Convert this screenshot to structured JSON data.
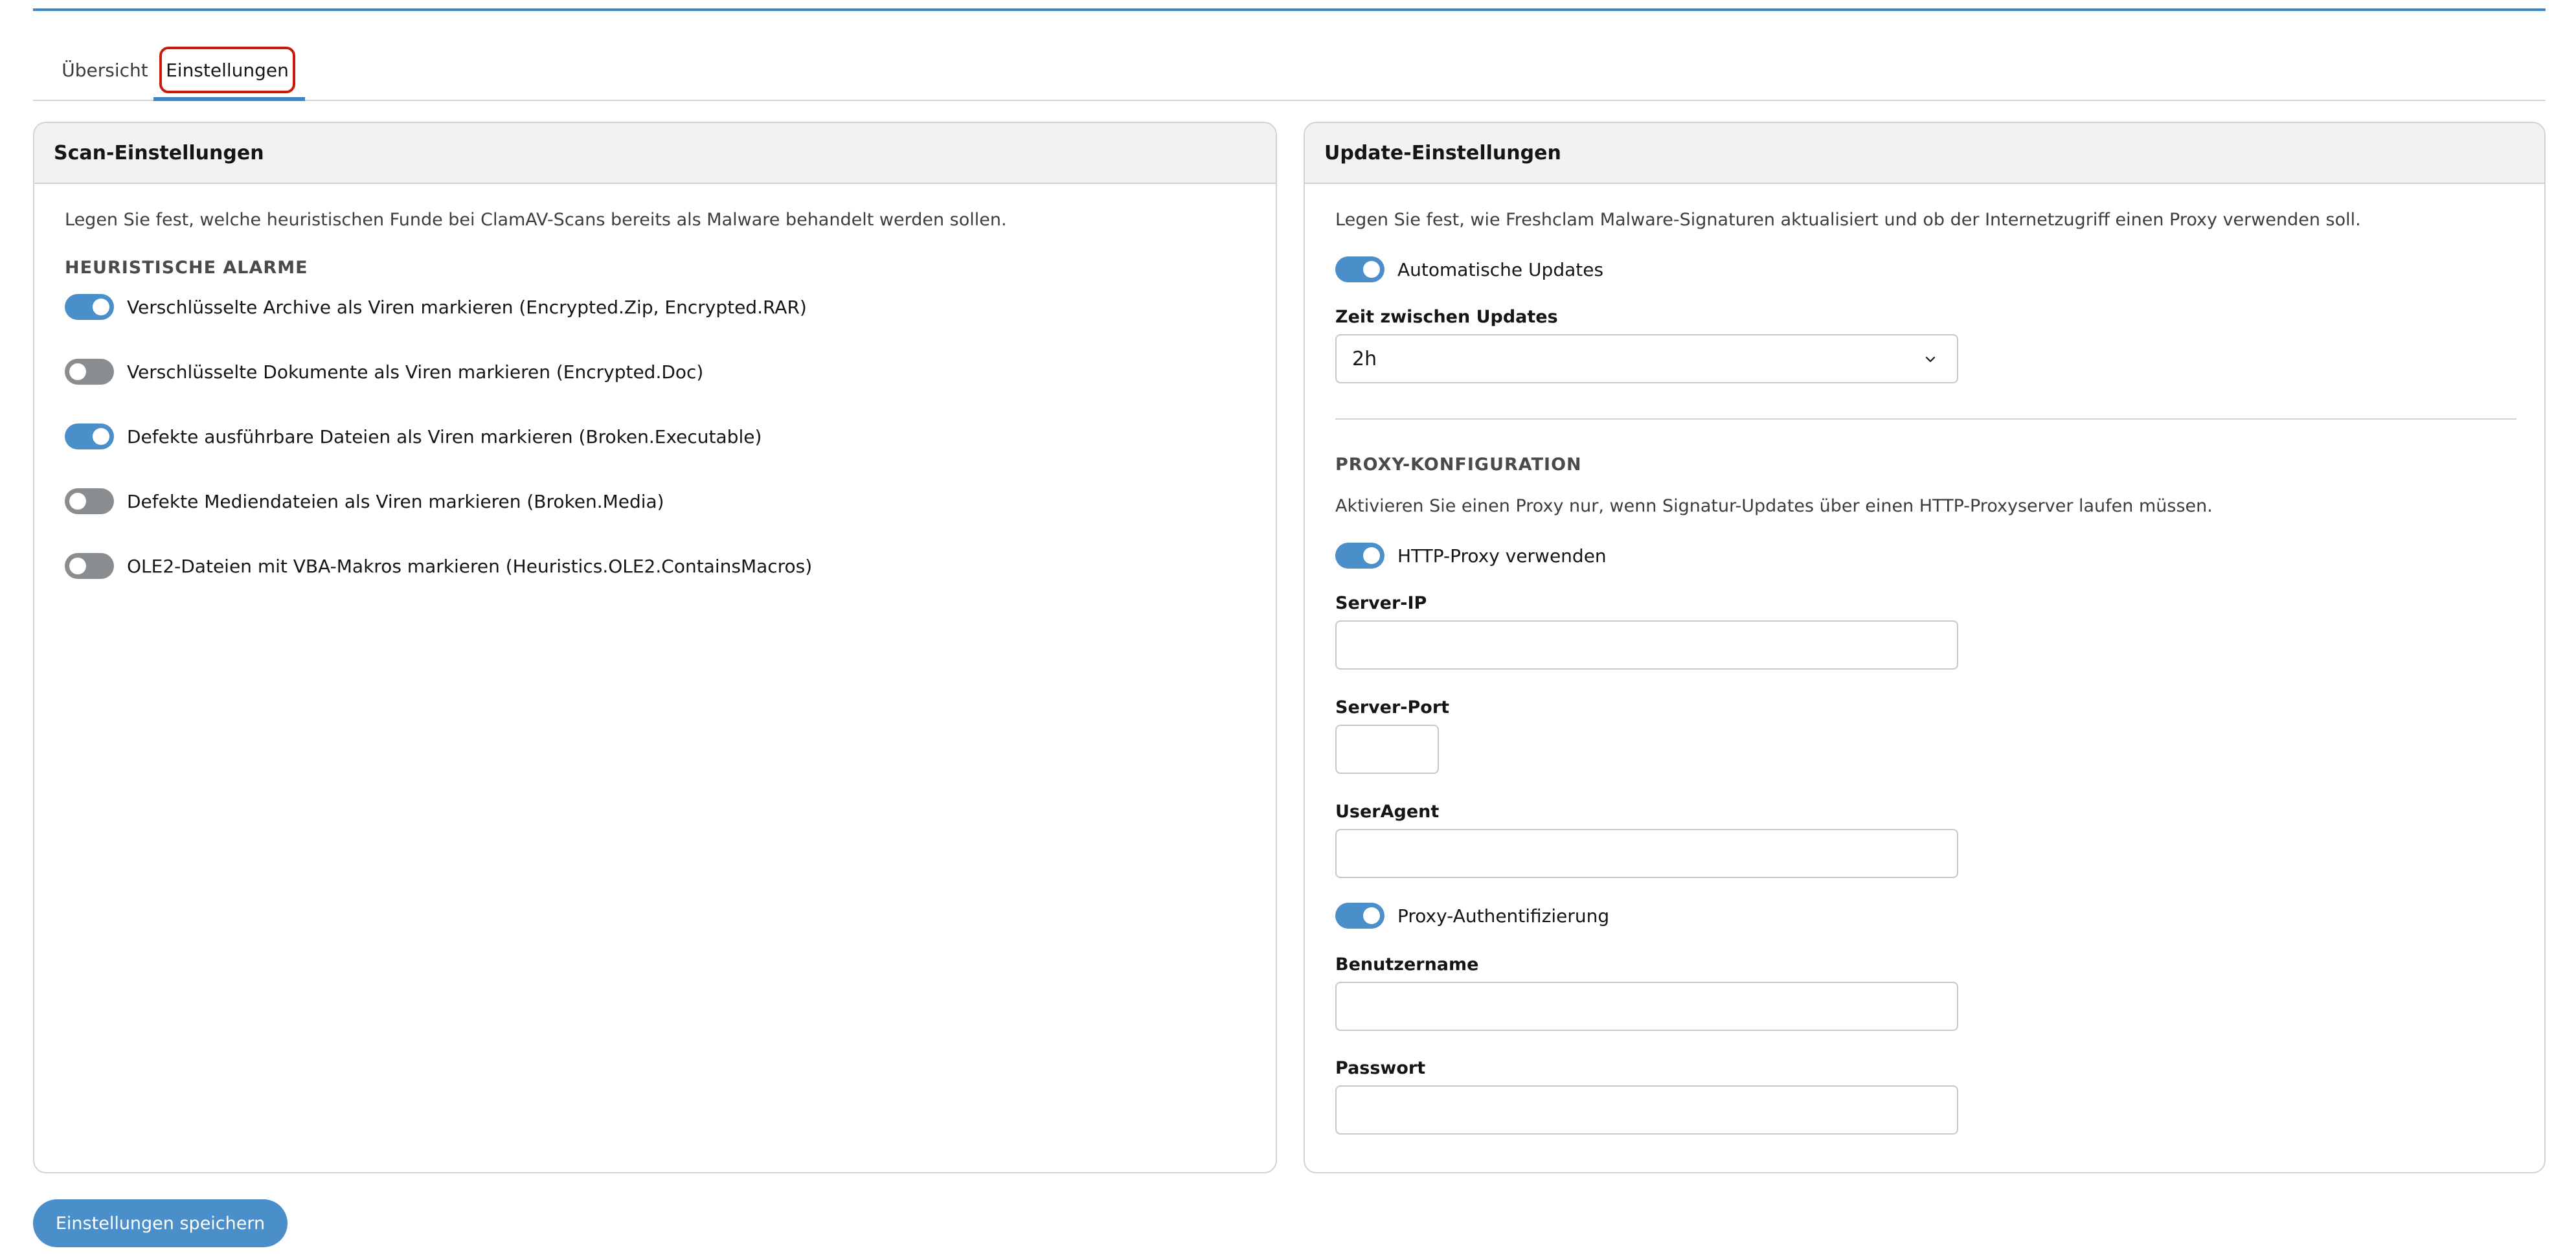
{
  "tabs": [
    {
      "label": "Übersicht"
    },
    {
      "label": "Einstellungen"
    }
  ],
  "scan": {
    "title": "Scan-Einstellungen",
    "description": "Legen Sie fest, welche heuristischen Funde bei ClamAV-Scans bereits als Malware behandelt werden sollen.",
    "section_title": "HEURISTISCHE ALARME",
    "toggles": [
      {
        "label": "Verschlüsselte Archive als Viren markieren (Encrypted.Zip, Encrypted.RAR)",
        "on": true
      },
      {
        "label": "Verschlüsselte Dokumente als Viren markieren (Encrypted.Doc)",
        "on": false
      },
      {
        "label": "Defekte ausführbare Dateien als Viren markieren (Broken.Executable)",
        "on": true
      },
      {
        "label": "Defekte Mediendateien als Viren markieren (Broken.Media)",
        "on": false
      },
      {
        "label": "OLE2-Dateien mit VBA-Makros markieren (Heuristics.OLE2.ContainsMacros)",
        "on": false
      }
    ]
  },
  "update": {
    "title": "Update-Einstellungen",
    "description": "Legen Sie fest, wie Freshclam Malware-Signaturen aktualisiert und ob der Internetzugriff einen Proxy verwenden soll.",
    "auto_updates": {
      "label": "Automatische Updates",
      "on": true
    },
    "interval_label": "Zeit zwischen Updates",
    "interval_value": "2h",
    "proxy_section_title": "PROXY-KONFIGURATION",
    "proxy_description": "Aktivieren Sie einen Proxy nur, wenn Signatur-Updates über einen HTTP-Proxyserver laufen müssen.",
    "use_proxy": {
      "label": "HTTP-Proxy verwenden",
      "on": true
    },
    "server_ip_label": "Server-IP",
    "server_ip_value": "",
    "server_port_label": "Server-Port",
    "server_port_value": "",
    "user_agent_label": "UserAgent",
    "user_agent_value": "",
    "proxy_auth": {
      "label": "Proxy-Authentifizierung",
      "on": true
    },
    "username_label": "Benutzername",
    "username_value": "",
    "password_label": "Passwort",
    "password_value": ""
  },
  "save_button_label": "Einstellungen speichern",
  "colors": {
    "accent": "#4a8fc9",
    "tab_highlight": "#c9190b",
    "toggle_off": "#8a8d90"
  }
}
